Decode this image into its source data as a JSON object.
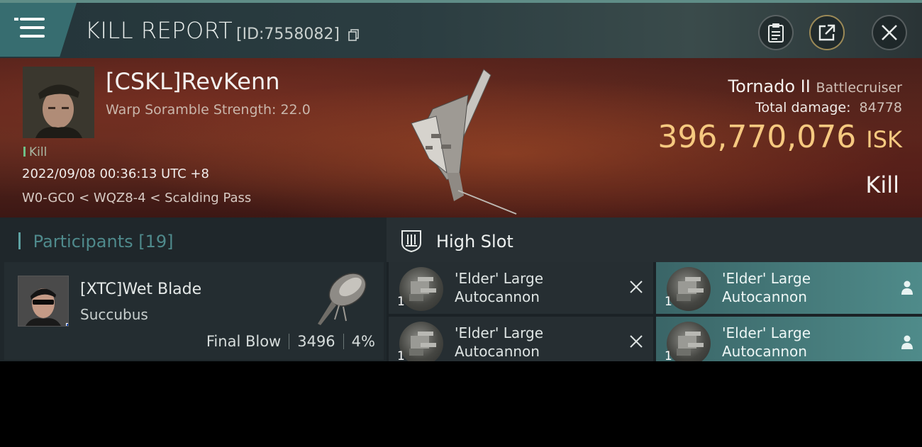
{
  "header": {
    "title": "KILL REPORT",
    "report_id": "[ID:7558082]"
  },
  "victim": {
    "name": "[CSKL]RevKenn",
    "warp_scramble": "Warp Soramble Strength: 22.0",
    "kill_tag": "Kill",
    "datetime": "2022/09/08 00:36:13 UTC +8",
    "location": "W0-GC0 < WQZ8-4 < Scalding Pass",
    "ship_name": "Tornado II",
    "ship_class": "Battlecruiser",
    "total_damage_label": "Total damage:",
    "total_damage": "84778",
    "isk_value": "396,770,076",
    "isk_unit": "ISK",
    "result": "Kill"
  },
  "participants": {
    "label": "Participants",
    "count": "[19]",
    "rows": [
      {
        "name": "[XTC]Wet Blade",
        "ship": "Succubus",
        "tag": "Final Blow",
        "damage": "3496",
        "percent": "4%"
      }
    ]
  },
  "high_slot": {
    "title": "High Slot",
    "modules": [
      {
        "name": "'Elder' Large Autocannon",
        "qty": "1",
        "status": "destroyed"
      },
      {
        "name": "'Elder' Large Autocannon",
        "qty": "1",
        "status": "dropped"
      },
      {
        "name": "'Elder' Large Autocannon",
        "qty": "1",
        "status": "destroyed"
      },
      {
        "name": "'Elder' Large Autocannon",
        "qty": "1",
        "status": "dropped"
      }
    ]
  },
  "colors": {
    "accent_teal": "#4f8b8a",
    "isk_gold": "#f6c980",
    "hero_red": "#5c2b1f"
  }
}
